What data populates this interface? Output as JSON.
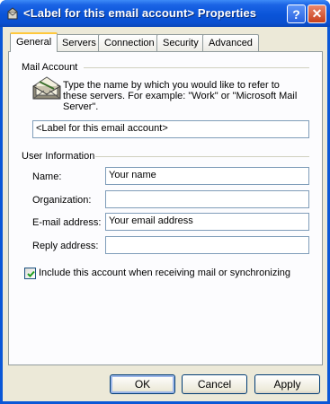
{
  "window": {
    "title": "<Label for this email account> Properties",
    "help_symbol": "?",
    "close_symbol": "✕"
  },
  "tabs": [
    {
      "label": "General",
      "active": true
    },
    {
      "label": "Servers",
      "active": false
    },
    {
      "label": "Connection",
      "active": false
    },
    {
      "label": "Security",
      "active": false
    },
    {
      "label": "Advanced",
      "active": false
    }
  ],
  "mail_account": {
    "group_label": "Mail Account",
    "description": "Type the name by which you would like to refer to these servers.  For example: \"Work\" or \"Microsoft Mail Server\".",
    "account_label_value": "<Label for this email account>"
  },
  "user_information": {
    "group_label": "User Information",
    "name_label": "Name:",
    "name_value": "Your name",
    "organization_label": "Organization:",
    "organization_value": "",
    "email_label": "E-mail address:",
    "email_value": "Your email address",
    "reply_label": "Reply address:",
    "reply_value": ""
  },
  "include_checkbox": {
    "label": "Include this account when receiving mail or synchronizing",
    "checked": true
  },
  "buttons": {
    "ok": "OK",
    "cancel": "Cancel",
    "apply": "Apply"
  },
  "colors": {
    "titlebar": "#0a54d8",
    "dialog_face": "#ece9d8",
    "tab_highlight": "#ffc83c"
  },
  "icons": {
    "title": "mail-account-icon",
    "description": "mail-envelope-icon",
    "checkbox": "checkmark-icon"
  }
}
